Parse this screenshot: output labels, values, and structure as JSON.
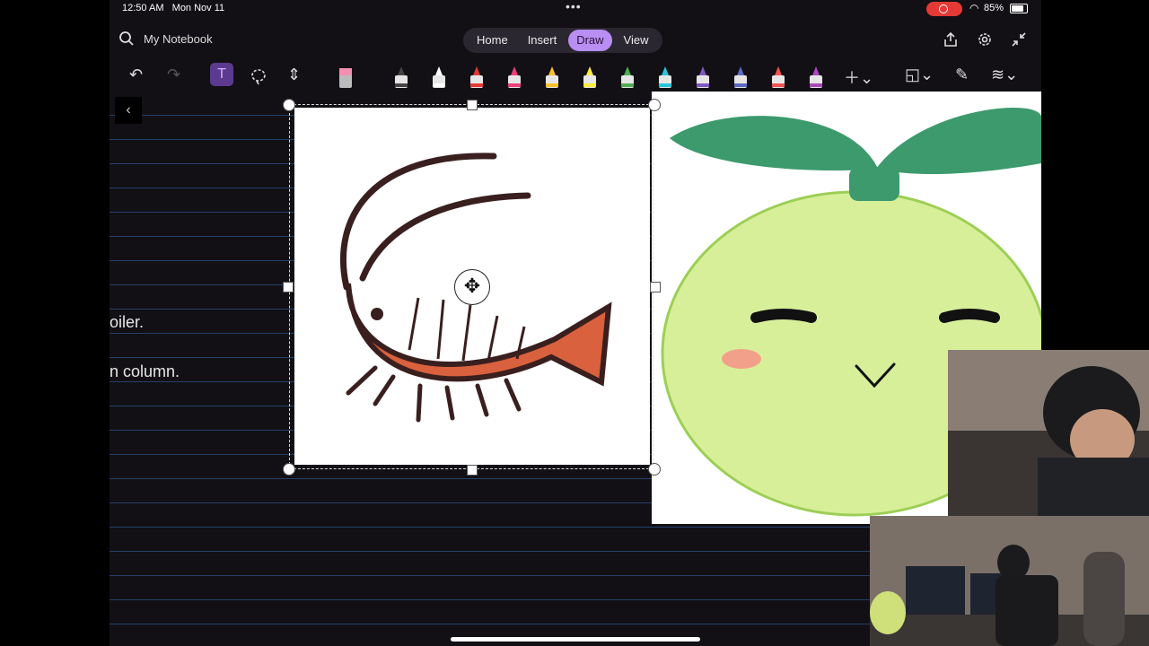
{
  "status": {
    "time": "12:50 AM",
    "date": "Mon Nov 11",
    "battery": "85%"
  },
  "notebook": {
    "name": "My Notebook"
  },
  "tabs": [
    {
      "label": "Home",
      "active": false
    },
    {
      "label": "Insert",
      "active": false
    },
    {
      "label": "Draw",
      "active": true
    },
    {
      "label": "View",
      "active": false
    }
  ],
  "toolbar": {
    "pens": [
      {
        "color": "#444444"
      },
      {
        "color": "#ffffff"
      },
      {
        "color": "#e53935"
      },
      {
        "color": "#ec407a"
      },
      {
        "color": "#fbc02d"
      },
      {
        "color": "#ffeb3b"
      },
      {
        "color": "#4caf50"
      },
      {
        "color": "#26c6da"
      },
      {
        "color": "#7e57c2"
      },
      {
        "color": "#5c6bc0"
      },
      {
        "color": "#ef5350"
      },
      {
        "color": "#ab47bc"
      }
    ]
  },
  "notes": [
    {
      "text": "oiler."
    },
    {
      "text": "n column."
    }
  ],
  "colors": {
    "accent": "#b98ef2",
    "rule_line": "#23406a",
    "shrimp": "#d9613d",
    "sprout_body": "#d8ef9a",
    "leaf": "#3c9a6c"
  }
}
